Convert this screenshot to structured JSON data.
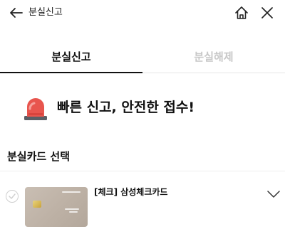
{
  "header": {
    "title": "분실신고",
    "back_icon": "arrow-left-icon",
    "home_icon": "home-icon",
    "close_icon": "close-icon"
  },
  "tabs": [
    {
      "label": "분실신고",
      "active": true
    },
    {
      "label": "분실해제",
      "active": false
    }
  ],
  "banner": {
    "icon": "siren-icon",
    "text": "빠른 신고, 안전한 접수!"
  },
  "card_section": {
    "title": "분실카드 선택",
    "cards": [
      {
        "name": "[체크] 삼성체크카드",
        "selected": false,
        "expand_icon": "chevron-down-icon"
      }
    ]
  },
  "colors": {
    "text": "#111111",
    "inactive_tab": "#c8c8c8",
    "siren_red": "#e8554e",
    "card_face": "#c4b8ac"
  }
}
